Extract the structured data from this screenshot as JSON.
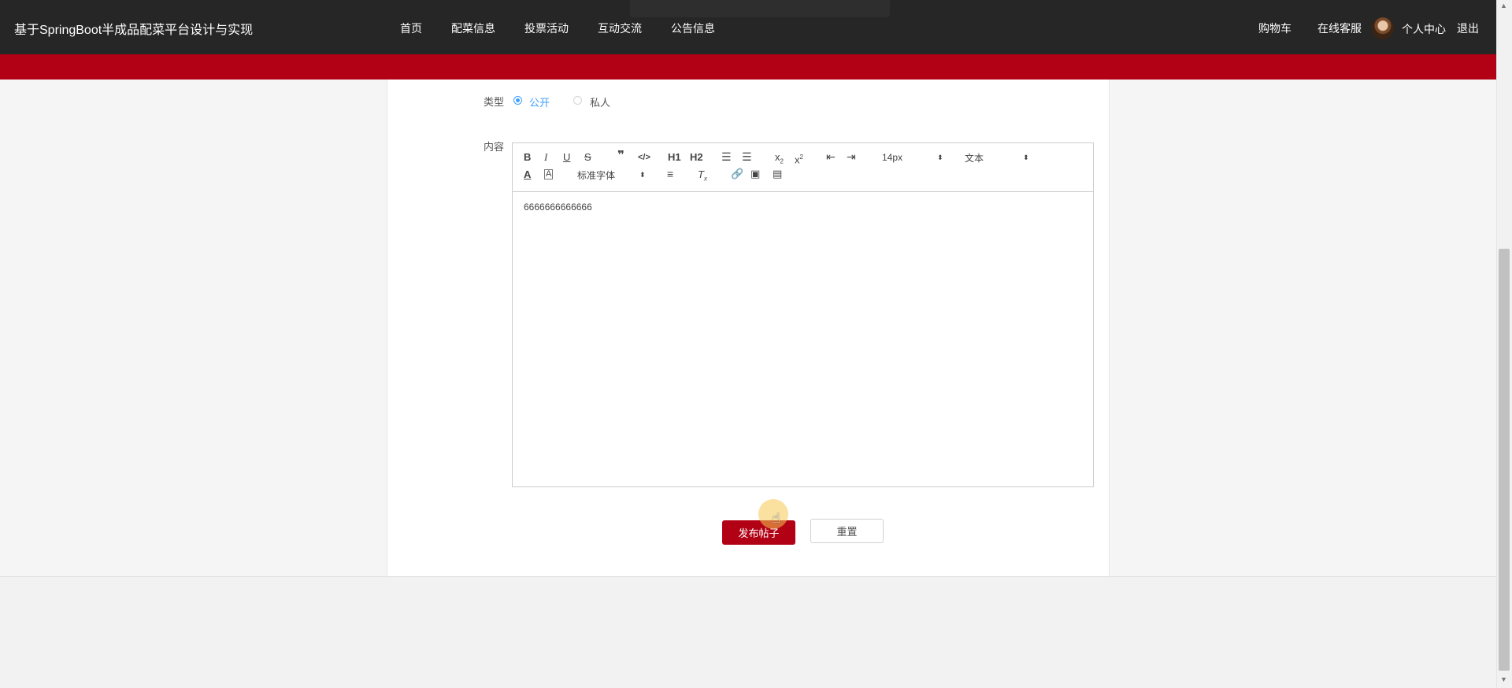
{
  "header": {
    "brand": "基于SpringBoot半成品配菜平台设计与实现",
    "nav": [
      "首页",
      "配菜信息",
      "投票活动",
      "互动交流",
      "公告信息"
    ],
    "cart": "购物车",
    "service": "在线客服",
    "profile": "个人中心",
    "logout": "退出"
  },
  "form": {
    "type_label": "类型",
    "type_options": [
      "公开",
      "私人"
    ],
    "type_selected": "公开",
    "content_label": "内容",
    "content_value": "6666666666666"
  },
  "toolbar": {
    "font_size": "14px",
    "heading_mode": "文本",
    "font_family": "标准字体",
    "h1": "H1",
    "h2": "H2"
  },
  "actions": {
    "submit": "发布帖子",
    "reset": "重置"
  },
  "colors": {
    "header_bg": "#262626",
    "accent_red": "#b20014",
    "radio_blue": "#409eff"
  }
}
